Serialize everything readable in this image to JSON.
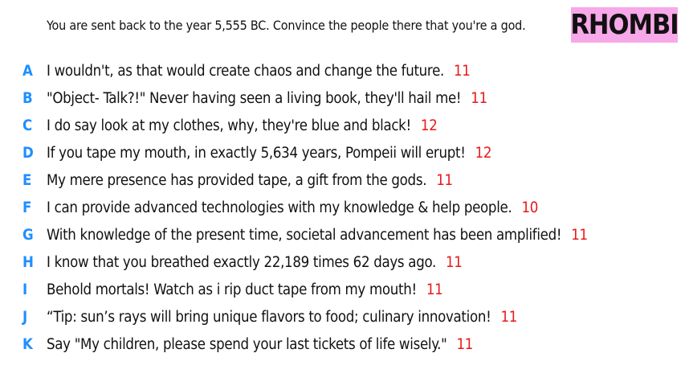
{
  "prompt": "You are sent back to the year 5,555 BC. Convince the people there that you're a god.",
  "badge": "RHOMBI",
  "colors": {
    "badge_bg": "#f7a8e8",
    "letter": "#1f8fff",
    "score": "#e81818",
    "text": "#111111"
  },
  "answers": [
    {
      "letter": "A",
      "text": "I wouldn't, as that would create chaos and change the future.",
      "score": "11"
    },
    {
      "letter": "B",
      "text": "\"Object- Talk?!\" Never having seen a living book, they'll hail me!",
      "score": "11"
    },
    {
      "letter": "C",
      "text": "I do say look at my clothes, why, they're blue and black!",
      "score": "12"
    },
    {
      "letter": "D",
      "text": "If you tape my mouth, in exactly 5,634 years, Pompeii will erupt!",
      "score": "12"
    },
    {
      "letter": "E",
      "text": "My mere presence has provided tape, a gift from the gods.",
      "score": "11"
    },
    {
      "letter": "F",
      "text": "I can provide advanced technologies with my knowledge & help people.",
      "score": "10"
    },
    {
      "letter": "G",
      "text": "With knowledge of the present time, societal advancement has been amplified!",
      "score": "11"
    },
    {
      "letter": "H",
      "text": "I know that you breathed exactly 22,189 times 62 days ago.",
      "score": "11"
    },
    {
      "letter": "I",
      "text": "Behold mortals! Watch as i rip duct tape from my mouth!",
      "score": "11"
    },
    {
      "letter": "J",
      "text": "“Tip: sun’s rays will bring unique flavors to food; culinary innovation!",
      "score": "11"
    },
    {
      "letter": "K",
      "text": "Say \"My children, please spend your last tickets of life wisely.\"",
      "score": "11"
    }
  ]
}
